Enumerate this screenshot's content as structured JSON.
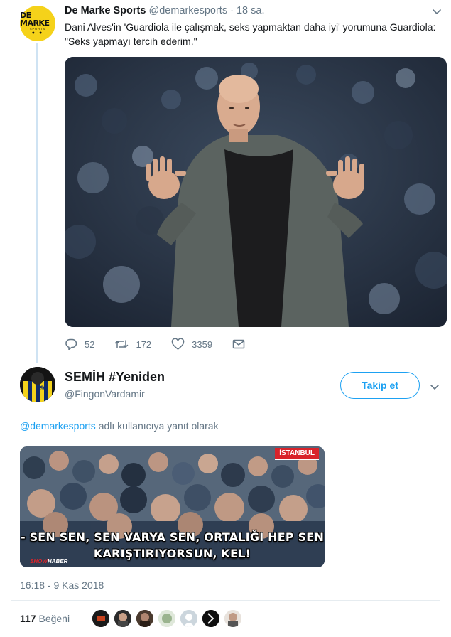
{
  "tweet": {
    "author_name": "De Marke Sports",
    "author_handle": "@demarkesports",
    "time": "· 18 sa.",
    "avatar_logo": "DE MARKE",
    "avatar_logo_sub": "SPORTS",
    "text": "Dani Alves'in 'Guardiola ile çalışmak, seks yapmaktan daha iyi' yorumuna Guardiola: \"Seks yapmayı tercih ederim.\"",
    "actions": {
      "reply_icon": "reply-icon",
      "reply_count": "52",
      "retweet_icon": "retweet-icon",
      "retweet_count": "172",
      "like_icon": "heart-icon",
      "like_count": "3359",
      "dm_icon": "envelope-icon"
    }
  },
  "reply": {
    "author_name": "SEMİH #Yeniden",
    "author_handle": "@FingonVardamir",
    "follow_label": "Takip et",
    "reply_to_mention": "@demarkesports",
    "reply_to_suffix": " adlı kullanıcıya yanıt olarak",
    "media_caption_line1": "- SEN SEN, SEN VARYA SEN, ORTALIĞI HEP SEN",
    "media_caption_line2": "KARIŞTIRIYORSUN, KEL!",
    "media_channel_tag": "İSTANBUL",
    "media_logo_show": "SHOW",
    "media_logo_haber": "HABER",
    "timestamp": "16:18 - 9 Kas 2018",
    "likes_count": "117",
    "likes_label": "Beğeni"
  },
  "colors": {
    "accent": "#1da1f2",
    "muted": "#657786",
    "text": "#14171a",
    "avatar_yellow": "#f5d21a"
  }
}
